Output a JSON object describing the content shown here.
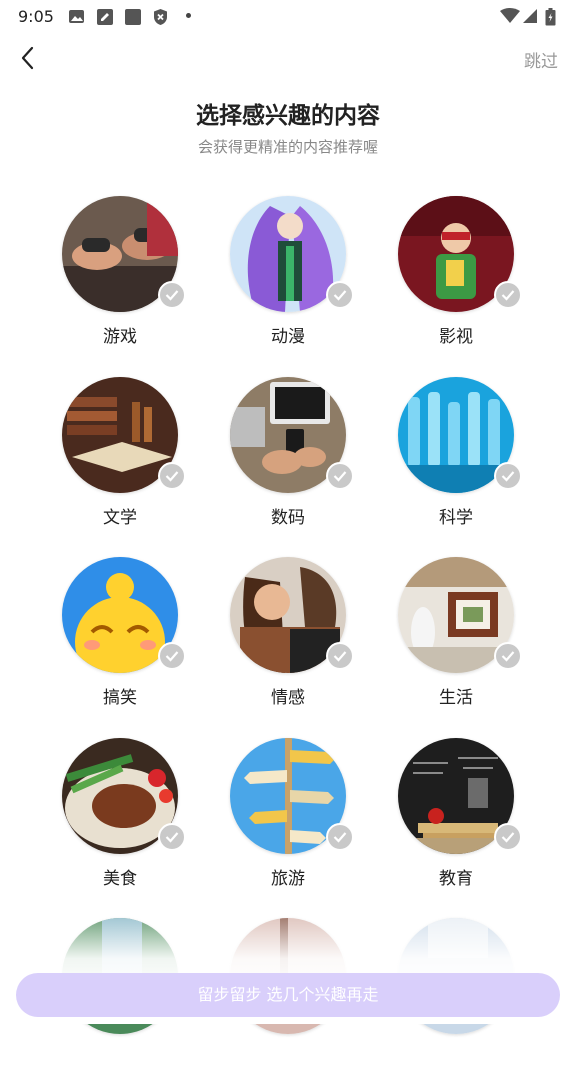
{
  "status_bar": {
    "time": "9:05",
    "icons": [
      "image-icon",
      "edit-icon",
      "square-icon",
      "shield-x-icon",
      "dot-icon",
      "wifi-icon",
      "signal-icon",
      "battery-icon"
    ]
  },
  "header": {
    "back_icon": "chevron-left-icon",
    "skip_label": "跳过"
  },
  "title": "选择感兴趣的内容",
  "subtitle": "会获得更精准的内容推荐喔",
  "interests": [
    {
      "label": "游戏",
      "selected": false
    },
    {
      "label": "动漫",
      "selected": false
    },
    {
      "label": "影视",
      "selected": false
    },
    {
      "label": "文学",
      "selected": false
    },
    {
      "label": "数码",
      "selected": false
    },
    {
      "label": "科学",
      "selected": false
    },
    {
      "label": "搞笑",
      "selected": false
    },
    {
      "label": "情感",
      "selected": false
    },
    {
      "label": "生活",
      "selected": false
    },
    {
      "label": "美食",
      "selected": false
    },
    {
      "label": "旅游",
      "selected": false
    },
    {
      "label": "教育",
      "selected": false
    }
  ],
  "submit_button": {
    "label": "留步留步 选几个兴趣再走",
    "color": "#d9cffb"
  },
  "colors": {
    "check": "#c9c9c9",
    "title": "#222222",
    "subtitle": "#888888"
  }
}
